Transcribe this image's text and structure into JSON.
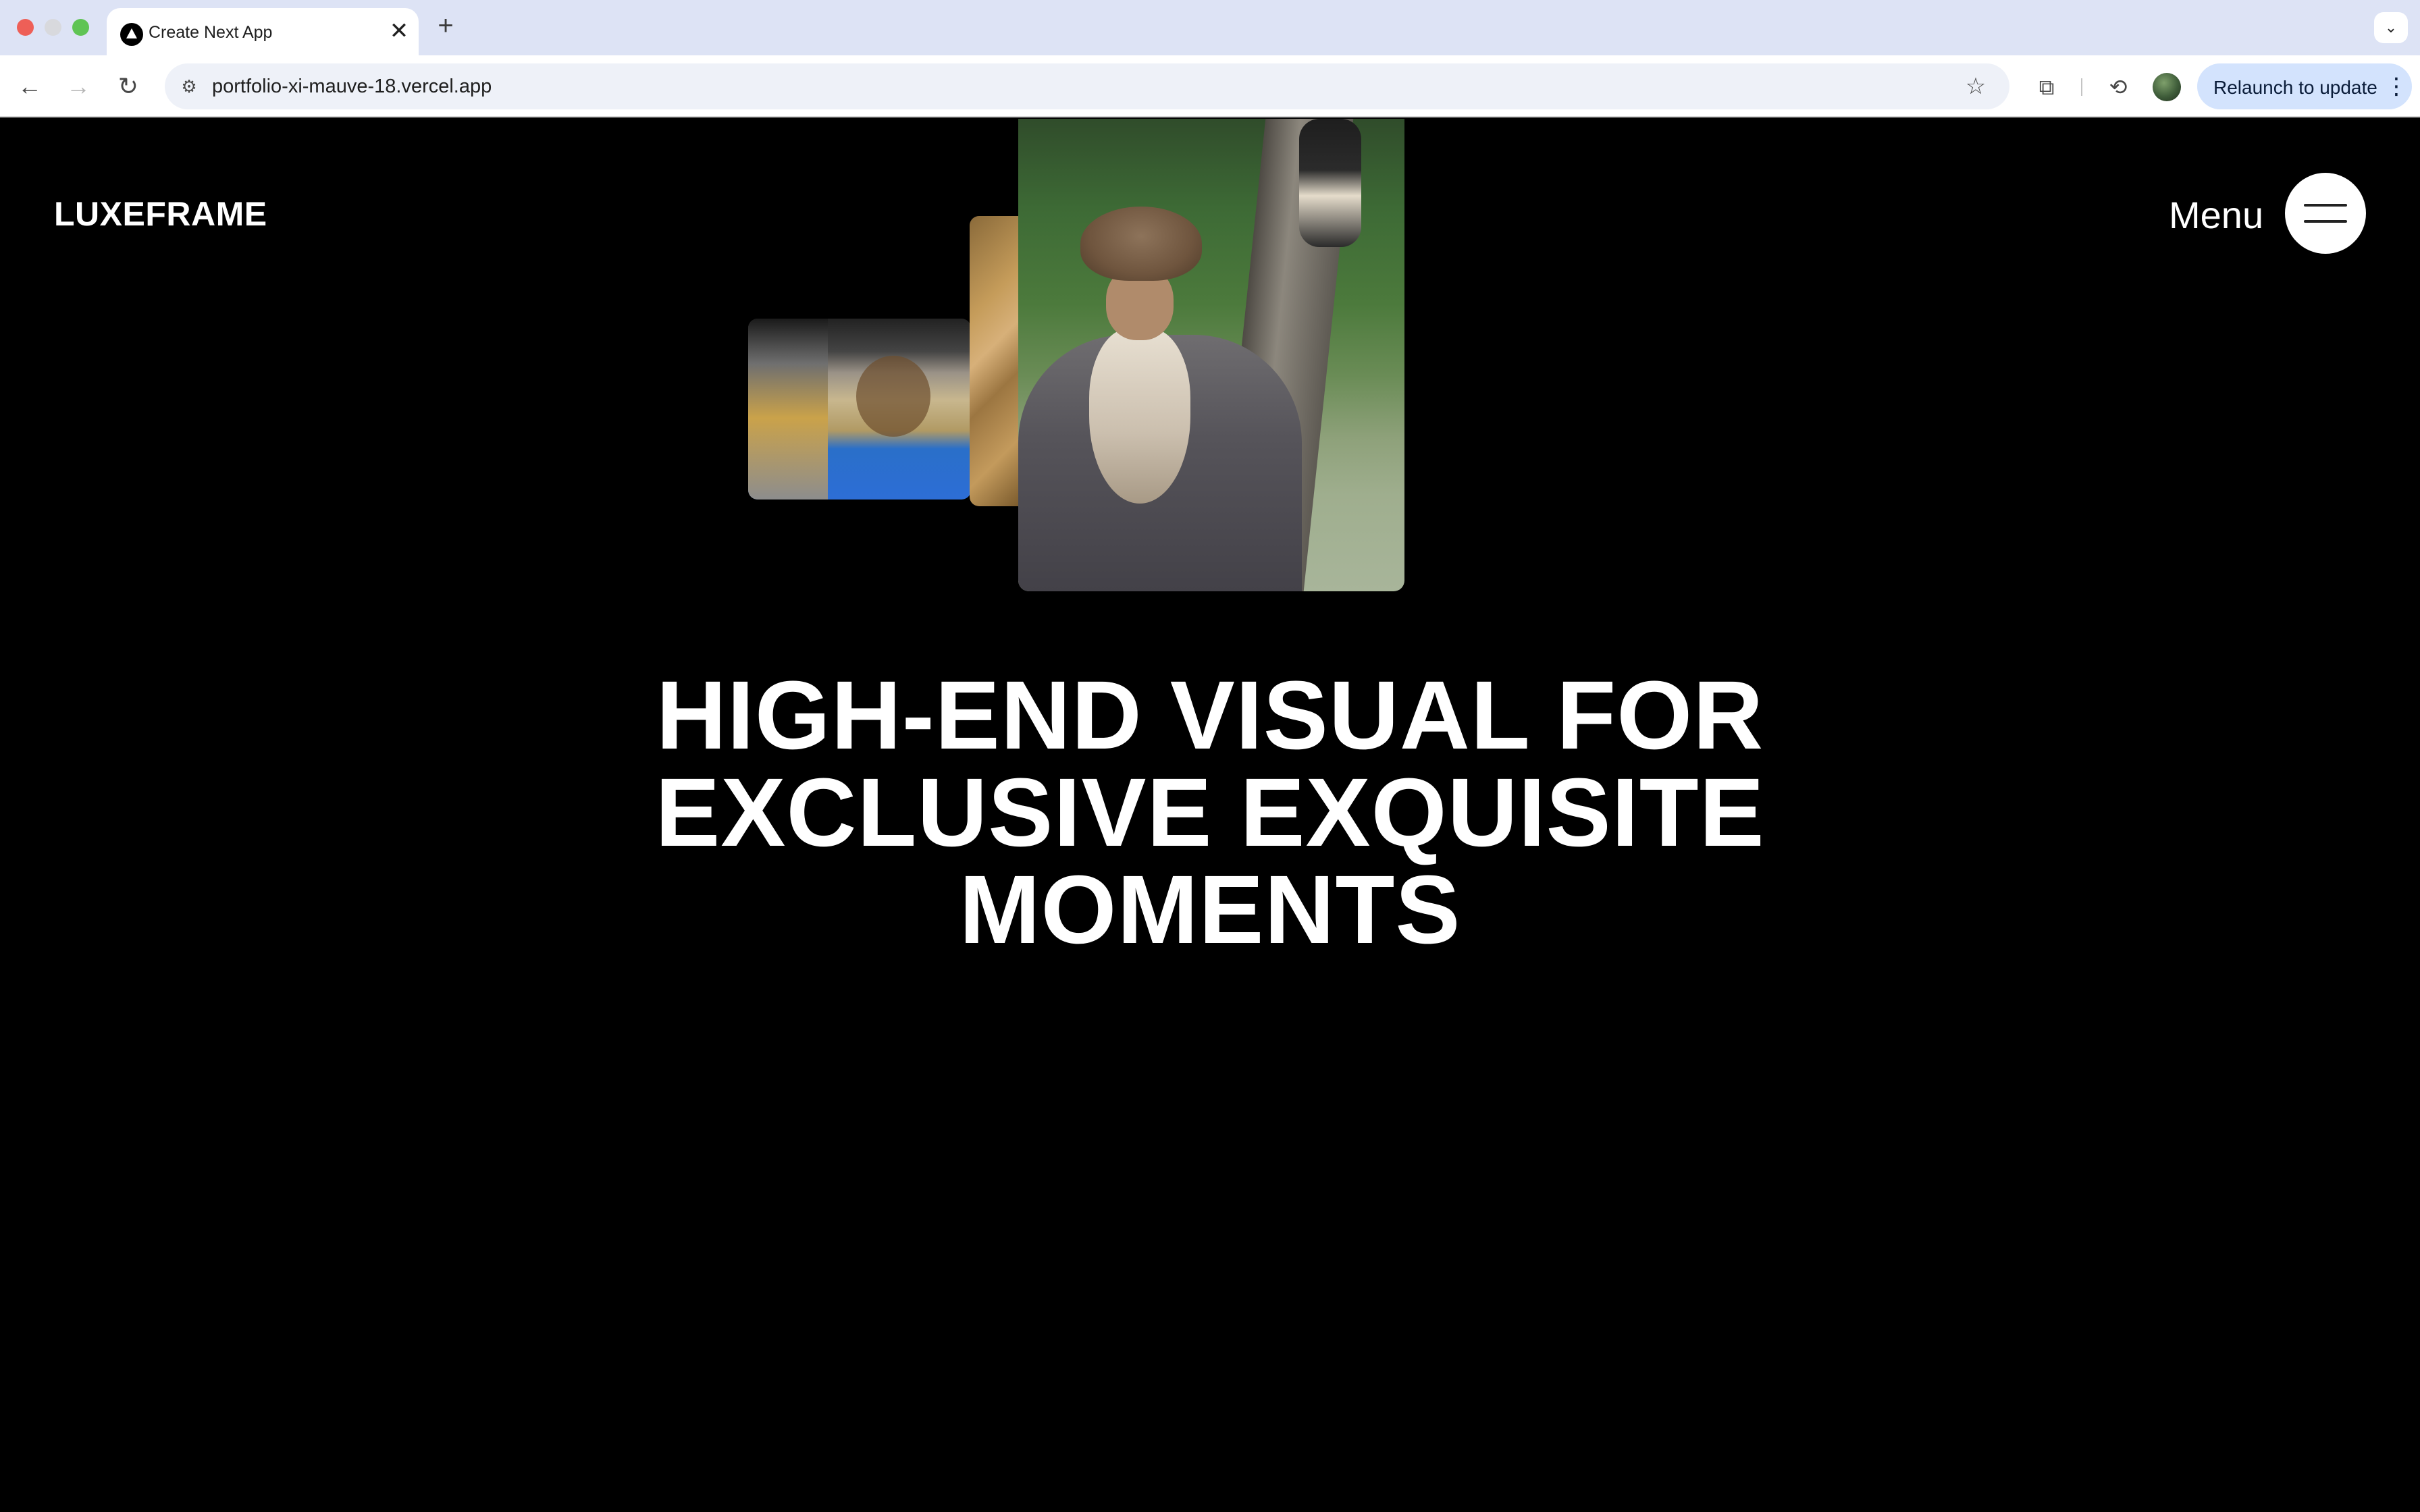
{
  "browser": {
    "tab_title": "Create Next App",
    "tab_close": "✕",
    "new_tab": "+",
    "tab_search": "⌄",
    "url": "portfolio-xi-mauve-18.vercel.app",
    "back": "←",
    "forward": "→",
    "reload": "↻",
    "site_info": "⚙",
    "bookmark": "☆",
    "extensions": "⧉",
    "performance": "⟲",
    "relaunch_label": "Relaunch to update",
    "relaunch_more": "⋮"
  },
  "site": {
    "logo": "LUXEFRAME",
    "menu_label": "Menu",
    "headline": {
      "line1": "HIGH-END VISUAL FOR",
      "line2": "EXCLUSIVE EXQUISITE",
      "line3": "MOMENTS"
    }
  },
  "colors": {
    "page_background": "#000000",
    "text": "#ffffff",
    "tabbar": "#dde3f5",
    "relaunch_button": "#d3e3fd"
  }
}
